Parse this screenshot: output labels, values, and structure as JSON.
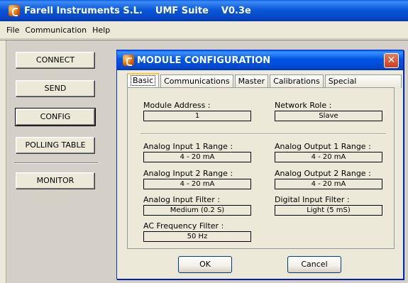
{
  "window": {
    "company": "Farell Instruments S.L.",
    "product": "UMF Suite",
    "version": "V0.3e",
    "icon": "app-icon"
  },
  "menu": [
    "File",
    "Communication",
    "Help"
  ],
  "buttons": {
    "connect": "CONNECT",
    "send": "SEND",
    "config": "CONFIG",
    "polling": "POLLING TABLE",
    "monitor": "MONITOR"
  },
  "dialog": {
    "title": "MODULE CONFIGURATION",
    "close": "✕",
    "tabs": [
      "Basic",
      "Communications",
      "Master",
      "Calibrations",
      "Special Operations"
    ],
    "active_tab": "Basic",
    "fields": {
      "module_address": {
        "label": "Module Address :",
        "value": "1"
      },
      "network_role": {
        "label": "Network Role :",
        "value": "Slave"
      },
      "ai1": {
        "label": "Analog Input 1 Range :",
        "value": "4 - 20 mA"
      },
      "ao1": {
        "label": "Analog Output 1 Range :",
        "value": "4 - 20 mA"
      },
      "ai2": {
        "label": "Analog Input 2 Range :",
        "value": "4 - 20 mA"
      },
      "ao2": {
        "label": "Analog Output 2 Range :",
        "value": "4 - 20 mA"
      },
      "ai_filter": {
        "label": "Analog Input Filter :",
        "value": "Medium (0.2 S)"
      },
      "di_filter": {
        "label": "Digital Input Filter :",
        "value": "Light (5 mS)"
      },
      "ac_filter": {
        "label": "AC Frequency Filter :",
        "value": "50 Hz"
      }
    },
    "ok": "OK",
    "cancel": "Cancel"
  }
}
